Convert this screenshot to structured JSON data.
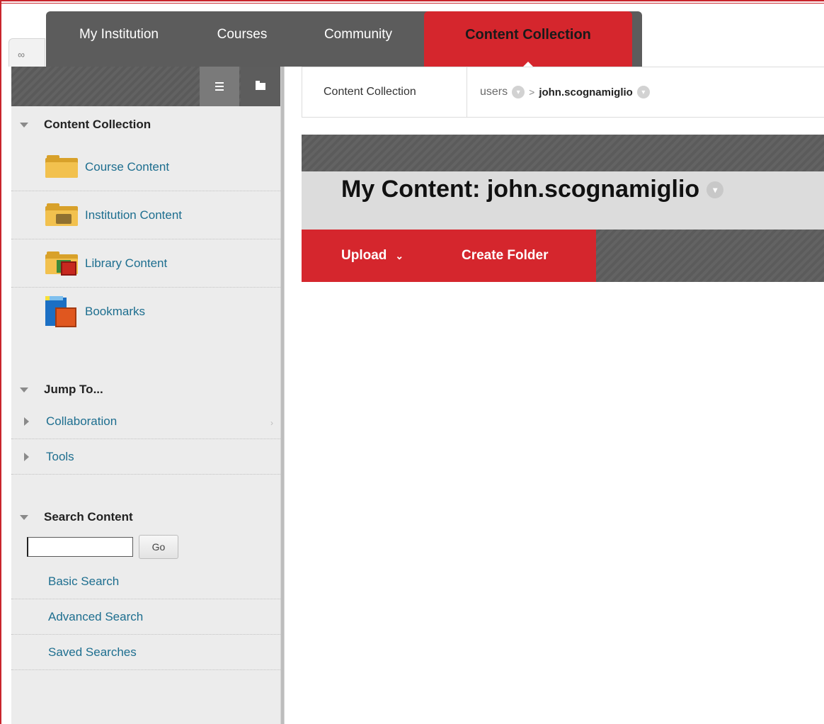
{
  "tabs": {
    "my_institution": "My Institution",
    "courses": "Courses",
    "community": "Community",
    "content_collection": "Content Collection"
  },
  "icons": {
    "pin": "pin-icon",
    "list_view": "list-view-icon",
    "folder_view": "folder-view-icon"
  },
  "sidebar": {
    "content_collection": {
      "heading": "Content Collection",
      "items": [
        {
          "label": "Course Content",
          "icon": "folder-icon"
        },
        {
          "label": "Institution Content",
          "icon": "institution-folder-icon"
        },
        {
          "label": "Library Content",
          "icon": "library-folder-icon"
        },
        {
          "label": "Bookmarks",
          "icon": "bookmarks-icon"
        }
      ]
    },
    "jump_to": {
      "heading": "Jump To...",
      "items": [
        "Collaboration",
        "Tools"
      ]
    },
    "search": {
      "heading": "Search Content",
      "input_value": "",
      "go_label": "Go",
      "links": [
        "Basic Search",
        "Advanced Search",
        "Saved Searches"
      ]
    }
  },
  "breadcrumb": {
    "root": "Content Collection",
    "users": "users",
    "current": "john.scognamiglio"
  },
  "main": {
    "title": "My Content: john.scognamiglio",
    "upload_label": "Upload",
    "create_folder_label": "Create Folder"
  },
  "colors": {
    "brand_red": "#d5262d",
    "tab_gray": "#5c5c5c",
    "link_teal": "#1d6e8f"
  }
}
